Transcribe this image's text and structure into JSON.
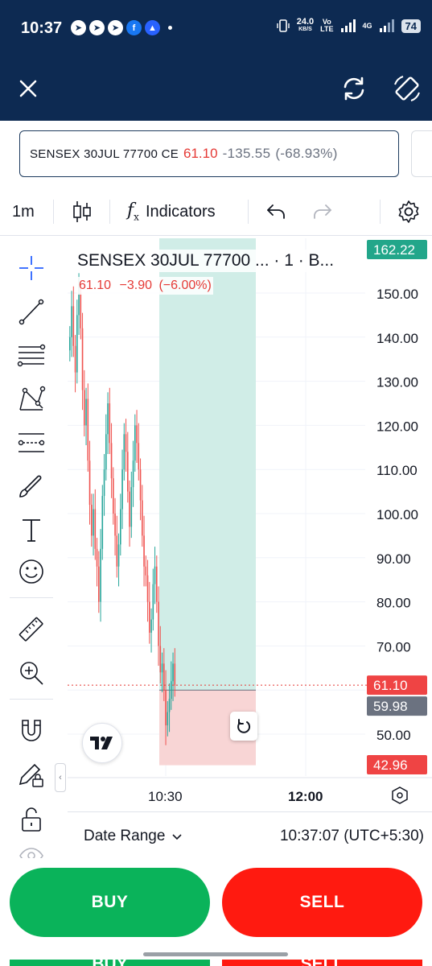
{
  "status_bar": {
    "time": "10:37",
    "app_icons": [
      "telegram-icon",
      "telegram-icon",
      "telegram-icon",
      "facebook-icon",
      "app-icon"
    ],
    "net_speed": "24.0",
    "net_unit": "KB/S",
    "volte_top": "Vo",
    "volte_bottom": "LTE",
    "net_type": "4G",
    "battery": "74"
  },
  "header": {
    "close_icon": "close-icon",
    "refresh_icon": "refresh-icon",
    "rotate_icon": "rotate-screen-icon"
  },
  "symbol_bar": {
    "symbol": "SENSEX 30JUL 77700 CE",
    "price": "61.10",
    "change": "-135.55",
    "change_pct": "(-68.93%)"
  },
  "toolbar": {
    "interval": "1m",
    "indicators_label": "Indicators"
  },
  "chart": {
    "title": "SENSEX 30JUL 77700 ... · 1 · B...",
    "ohlc_price": "61.10",
    "ohlc_change": "−3.90",
    "ohlc_change_pct": "(−6.00%)",
    "price_labels": [
      "150.00",
      "140.00",
      "130.00",
      "120.00",
      "110.00",
      "100.00",
      "90.00",
      "80.00",
      "70.00",
      "50.00"
    ],
    "target_label": "162.22",
    "current_label": "61.10",
    "entry_label": "59.98",
    "stop_label": "42.96",
    "time_labels": [
      "10:30",
      "12:00"
    ],
    "colors": {
      "up": "#26a69a",
      "down": "#ef5350",
      "target_zone": "#d0ede7",
      "stop_zone": "#f8d5d5",
      "target_badge": "#22a68a",
      "current_badge": "#ef4444",
      "entry_badge": "#6b7280"
    }
  },
  "chart_data": {
    "type": "candlestick",
    "title": "SENSEX 30JUL 77700 ... · 1 · B...",
    "ylim": [
      40,
      165
    ],
    "y_ticks": [
      50,
      60,
      70,
      80,
      90,
      100,
      110,
      120,
      130,
      140,
      150
    ],
    "x_ticks": [
      "10:30",
      "12:00"
    ],
    "close_series": [
      140,
      147,
      138,
      132,
      145,
      150,
      142,
      128,
      120,
      126,
      112,
      102,
      95,
      101,
      92,
      88,
      80,
      92,
      104,
      110,
      118,
      125,
      116,
      108,
      100,
      95,
      88,
      93,
      101,
      110,
      118,
      114,
      105,
      97,
      106,
      112,
      120,
      116,
      110,
      103,
      95,
      88,
      86,
      80,
      73,
      76,
      84,
      88,
      80,
      70,
      64,
      66,
      60,
      52,
      55,
      58,
      62,
      66,
      61
    ],
    "long_position": {
      "entry": 59.98,
      "target": 162.22,
      "stop": 42.96,
      "current": 61.1
    }
  },
  "date_bar": {
    "date_range_label": "Date Range",
    "time_readout": "10:37:07 (UTC+5:30)"
  },
  "actions": {
    "buy_label": "BUY",
    "sell_label": "SELL"
  }
}
